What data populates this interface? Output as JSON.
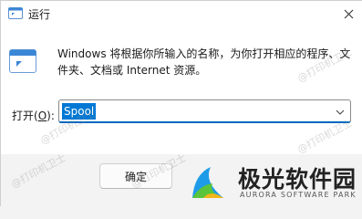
{
  "window": {
    "title": "运行",
    "app_icon": "run-icon",
    "close_icon": "close-icon"
  },
  "content": {
    "description": "Windows 将根据你所输入的名称，为你打开相应的程序、文件夹、文档或 Internet 资源。",
    "open_label": "打开(",
    "open_label_accel": "O",
    "open_label_end": "):",
    "combo_value": "Spool",
    "combo_arrow_icon": "chevron-down-icon"
  },
  "footer": {
    "ok_label": "确定"
  },
  "watermark": {
    "text": "@打印机卫士"
  },
  "brand": {
    "name": "极光软件园",
    "subtitle": "AURORA SOFTWARE PARK",
    "logo_icon": "aurora-logo-icon"
  },
  "colors": {
    "accent": "#0078d4",
    "focus_underline": "#0067c0",
    "logo_blue": "#1e9be8",
    "logo_green": "#5ac43a"
  }
}
